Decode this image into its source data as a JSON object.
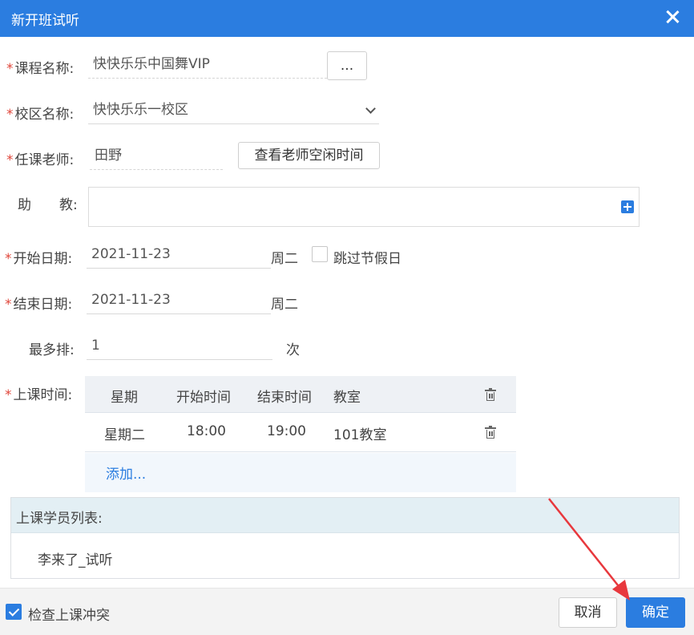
{
  "dialog": {
    "title": "新开班试听"
  },
  "form": {
    "course": {
      "label": "课程名称:",
      "value": "快快乐乐中国舞VIP",
      "button": "..."
    },
    "campus": {
      "label": "校区名称:",
      "value": "快快乐乐一校区"
    },
    "teacher": {
      "label": "任课老师:",
      "value": "田野",
      "button": "查看老师空闲时间"
    },
    "assistant": {
      "label_a": "助",
      "label_b": "教:"
    },
    "start_date": {
      "label": "开始日期:",
      "value": "2021-11-23",
      "weekday": "周二",
      "skip_holiday_label": "跳过节假日"
    },
    "end_date": {
      "label": "结束日期:",
      "value": "2021-11-23",
      "weekday": "周二"
    },
    "max_count": {
      "label": "最多排:",
      "value": "1",
      "unit": "次"
    },
    "schedule": {
      "label": "上课时间:",
      "columns": [
        "星期",
        "开始时间",
        "结束时间",
        "教室"
      ],
      "rows": [
        {
          "weekday": "星期二",
          "start": "18:00",
          "end": "19:00",
          "room": "101教室"
        }
      ],
      "add_label": "添加..."
    }
  },
  "students": {
    "header": "上课学员列表:",
    "items": [
      "李来了_试听"
    ]
  },
  "footer": {
    "check_conflict_label": "检查上课冲突",
    "cancel_label": "取消",
    "confirm_label": "确定"
  },
  "colors": {
    "accent": "#2b7de0",
    "required": "#e0463a",
    "annotation_arrow": "#e8383d"
  },
  "icons": {
    "close": "close-icon",
    "select": "chevron-down-icon",
    "add": "plus-icon",
    "delete": "trash-icon",
    "check": "checkbox-checked-icon"
  }
}
